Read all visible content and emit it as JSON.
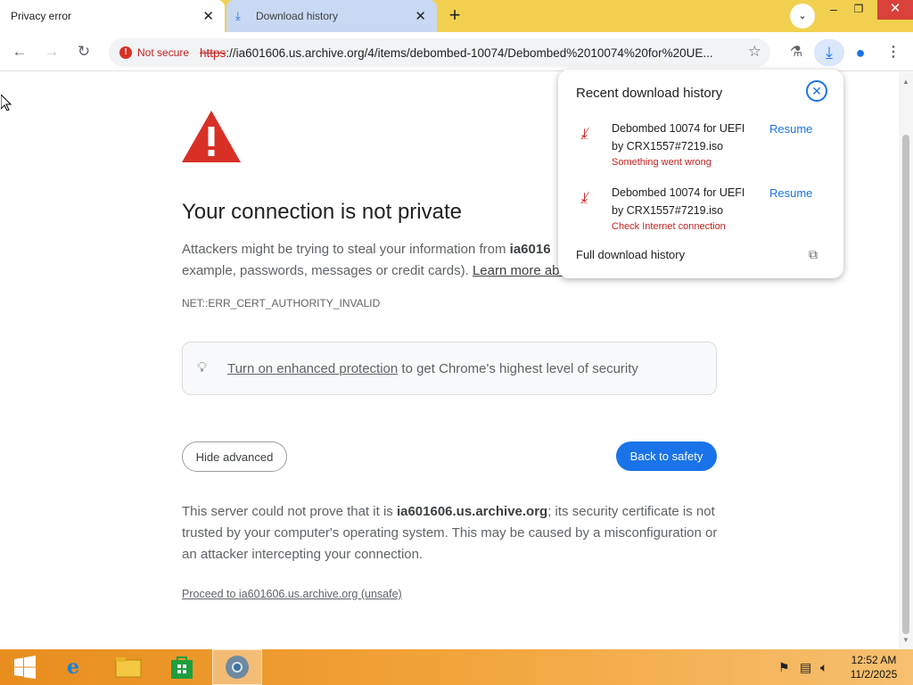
{
  "tabs": [
    {
      "title": "Privacy error",
      "active": true
    },
    {
      "title": "Download history",
      "active": false,
      "icon": "download-icon"
    }
  ],
  "toolbar": {
    "not_secure_label": "Not secure",
    "url_scheme": "https",
    "url_rest": "://ia601606.us.archive.org/4/items/debombed-10074/Debombed%2010074%20for%20UE..."
  },
  "page": {
    "heading": "Your connection is not private",
    "intro_1": "Attackers might be trying to steal your information from ",
    "intro_host": "ia6016",
    "intro_2": "example, passwords, messages or credit cards). ",
    "learn_more": "Learn more abou",
    "error_code": "NET::ERR_CERT_AUTHORITY_INVALID",
    "enhanced_link": "Turn on enhanced protection",
    "enhanced_rest": " to get Chrome's highest level of security",
    "hide_advanced": "Hide advanced",
    "back_to_safety": "Back to safety",
    "detail_1": "This server could not prove that it is ",
    "detail_host": "ia601606.us.archive.org",
    "detail_2": "; its security certificate is not trusted by your computer's operating system. This may be caused by a misconfiguration or an attacker intercepting your connection.",
    "proceed": "Proceed to ia601606.us.archive.org (unsafe)"
  },
  "downloads": {
    "title": "Recent download history",
    "items": [
      {
        "name": "Debombed 10074 for UEFI by CRX1557#7219.iso",
        "status": "Something went wrong",
        "action": "Resume"
      },
      {
        "name": "Debombed 10074 for UEFI by CRX1557#7219.iso",
        "status": "Check Internet connection",
        "action": "Resume"
      }
    ],
    "full_history": "Full download history"
  },
  "taskbar": {
    "time": "12:52 AM",
    "date": "11/2/2025"
  },
  "colors": {
    "accent": "#1a73e8",
    "error": "#c5221f",
    "tabbar": "#f2d04f"
  }
}
